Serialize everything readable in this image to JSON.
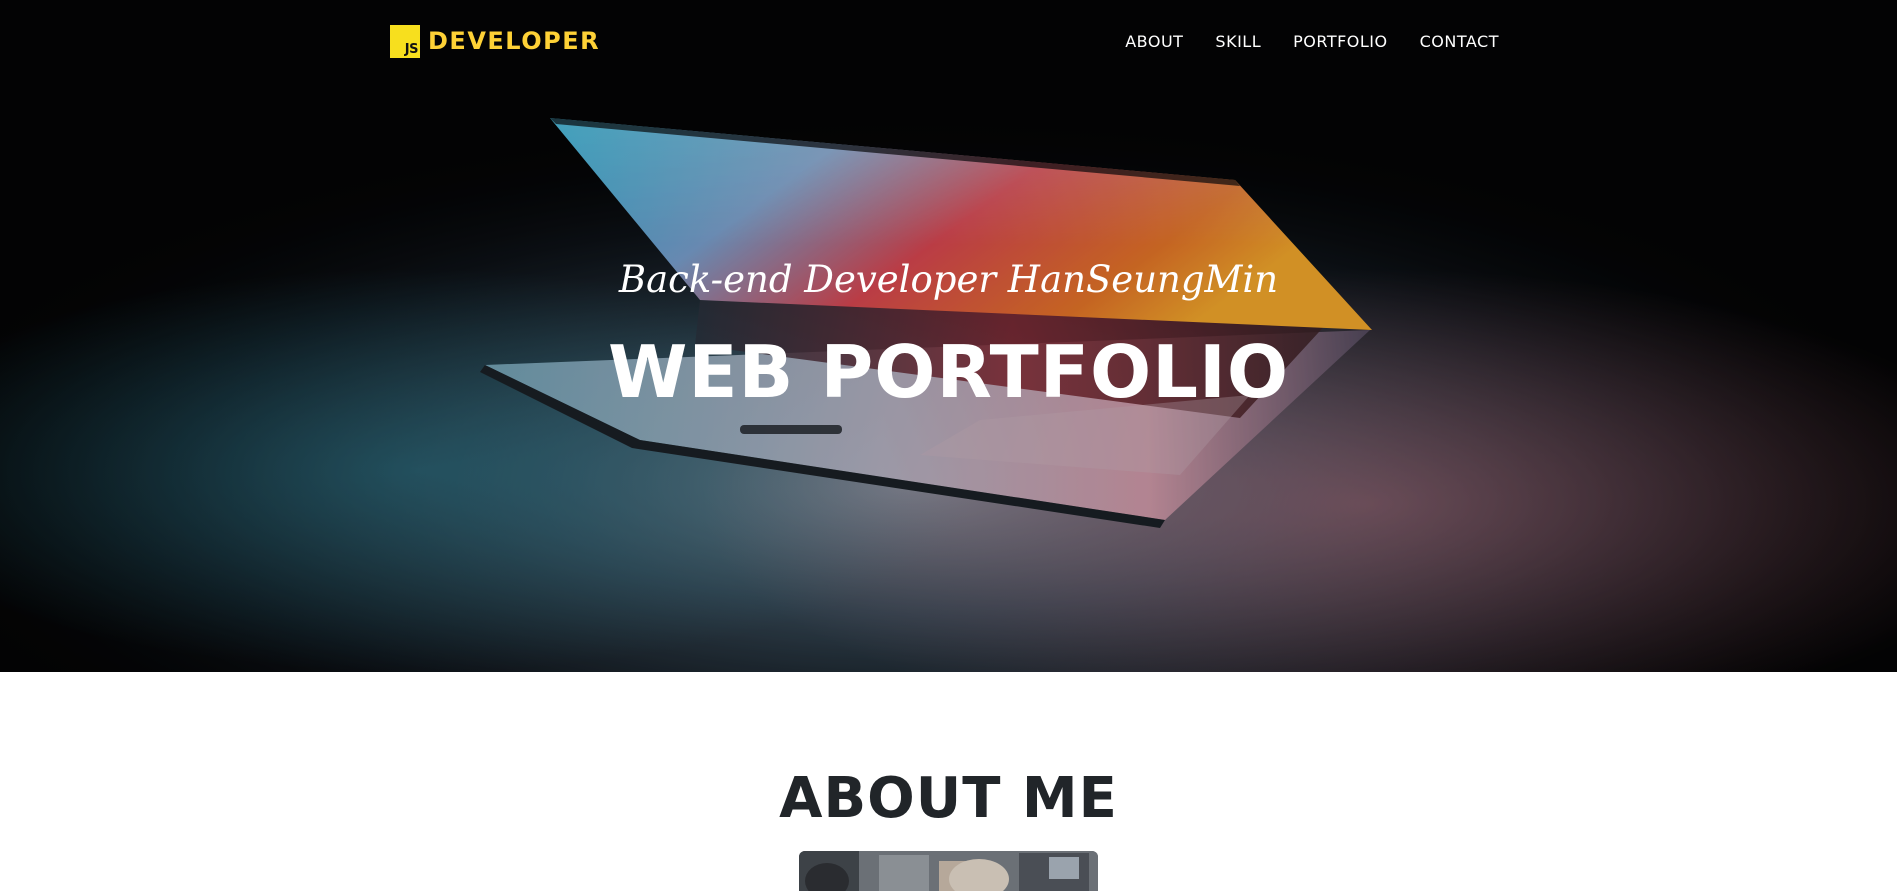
{
  "navbar": {
    "logo_icon": "js-logo-icon",
    "logo_badge": "JS",
    "brand": "DEVELOPER",
    "items": [
      {
        "label": "ABOUT"
      },
      {
        "label": "SKILL"
      },
      {
        "label": "PORTFOLIO"
      },
      {
        "label": "CONTACT"
      }
    ]
  },
  "hero": {
    "subtitle": "Back-end Developer HanSeungMin",
    "title": "WEB PORTFOLIO",
    "background": "laptop-photo"
  },
  "about": {
    "heading": "ABOUT ME",
    "photo": "profile-photo"
  },
  "colors": {
    "accent": "#fed136",
    "js_yellow": "#f7df1e",
    "hero_text": "#ffffff",
    "heading_text": "#212529"
  }
}
